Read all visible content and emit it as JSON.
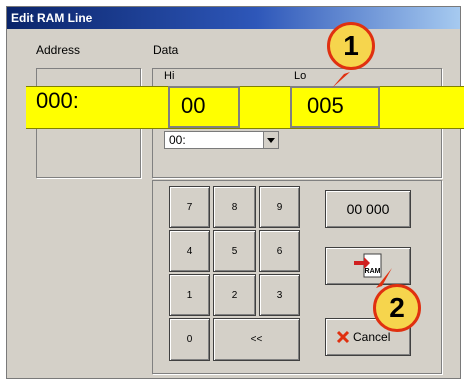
{
  "window": {
    "title": "Edit RAM Line"
  },
  "labels": {
    "address": "Address",
    "data": "Data",
    "hi": "Hi",
    "lo": "Lo"
  },
  "address_value": "000:",
  "hi_value": "00",
  "lo_value": "005",
  "dropdown": {
    "selected": "00:"
  },
  "keypad": {
    "keys": [
      "7",
      "8",
      "9",
      "4",
      "5",
      "6",
      "1",
      "2",
      "3",
      "0",
      "<<"
    ]
  },
  "buttons": {
    "value_display": "00 000",
    "ram_icon_text": "RAM",
    "cancel": "Cancel"
  },
  "callouts": [
    "1",
    "2"
  ],
  "colors": {
    "highlight": "#ffff00",
    "callout_fill": "#f6d54d",
    "callout_border": "#e03010",
    "arrow": "#e03010"
  }
}
